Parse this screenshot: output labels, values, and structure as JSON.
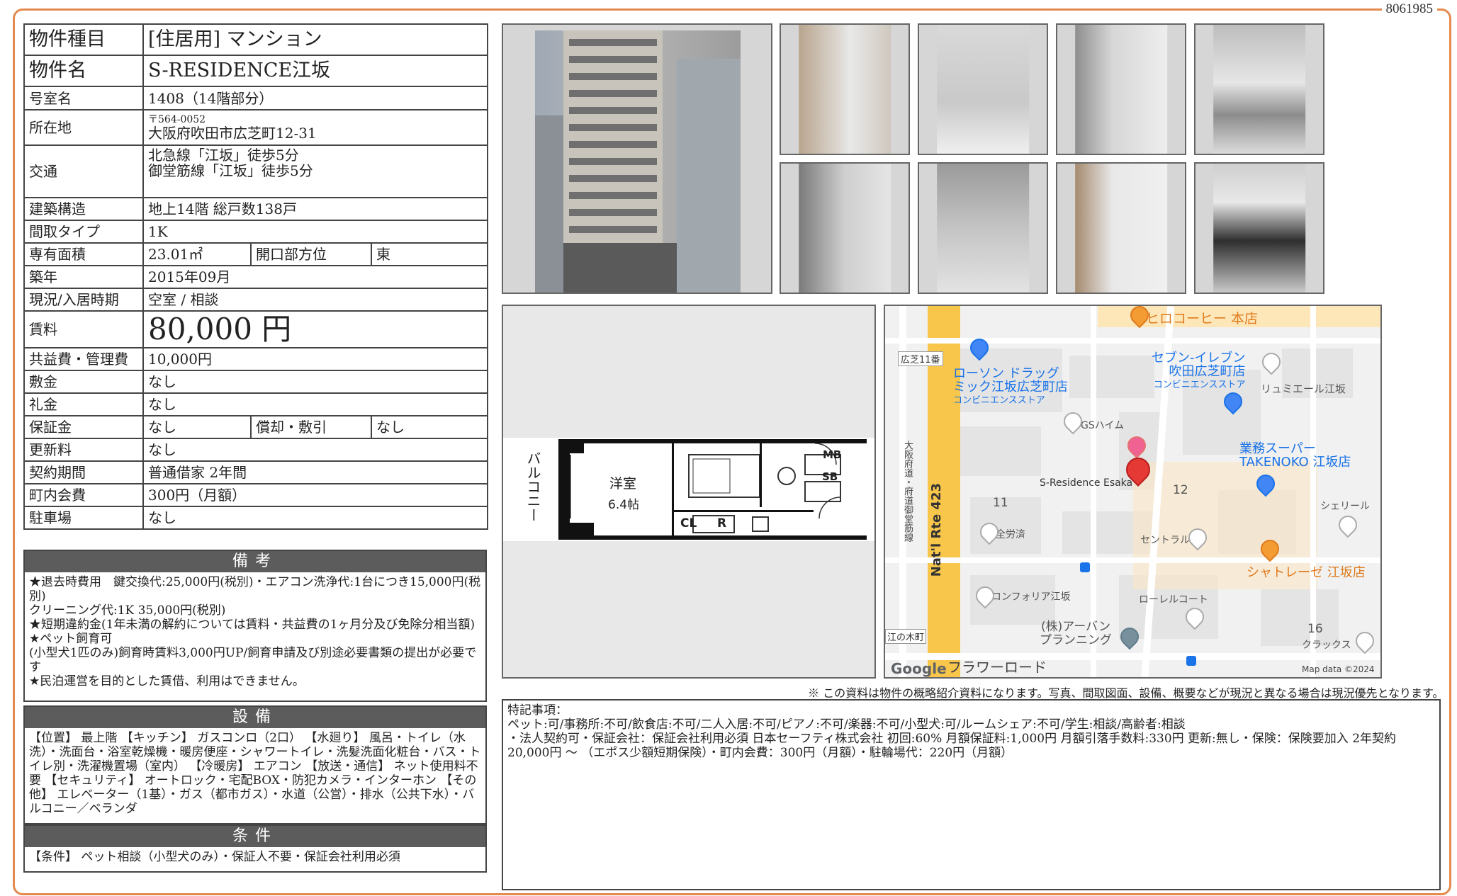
{
  "doc_number": "8061985",
  "property": {
    "type_label": "物件種目",
    "type_value": "[住居用] マンション",
    "name_label": "物件名",
    "name_value": "S-RESIDENCE江坂",
    "room_label": "号室名",
    "room_value": "1408（14階部分）",
    "address_label": "所在地",
    "postal": "〒564-0052",
    "address": "大阪府吹田市広芝町12-31",
    "access_label": "交通",
    "access_1": "北急線「江坂」徒歩5分",
    "access_2": "御堂筋線「江坂」徒歩5分",
    "structure_label": "建築構造",
    "structure_value": "地上14階 総戸数138戸",
    "layout_label": "間取タイプ",
    "layout_value": "1K",
    "area_label": "専有面積",
    "area_value": "23.01㎡",
    "facing_label": "開口部方位",
    "facing_value": "東",
    "built_label": "築年",
    "built_value": "2015年09月",
    "status_label": "現況/入居時期",
    "status_value": "空室 / 相談",
    "rent_label": "賃料",
    "rent_value": "80,000 円",
    "fee_label": "共益費・管理費",
    "fee_value": "10,000円",
    "deposit_label": "敷金",
    "deposit_value": "なし",
    "key_money_label": "礼金",
    "key_money_value": "なし",
    "guarantee_label": "保証金",
    "guarantee_value": "なし",
    "amort_label": "償却・敷引",
    "amort_value": "なし",
    "renewal_label": "更新料",
    "renewal_value": "なし",
    "contract_label": "契約期間",
    "contract_value": "普通借家 2年間",
    "town_fee_label": "町内会費",
    "town_fee_value": "300円（月額）",
    "parking_label": "駐車場",
    "parking_value": "なし"
  },
  "remarks_section": {
    "title": "備考",
    "text": "★退去時費用　鍵交換代:25,000円(税別)・エアコン洗浄代:1台につき15,000円(税別)\nクリーニング代:1K 35,000円(税別)\n★短期違約金(1年未満の解約については賃料・共益費の1ヶ月分及び免除分相当額)\n★ペット飼育可\n(小型犬1匹のみ)飼育時賃料3,000円UP/飼育申請及び別途必要書類の提出が必要です\n★民泊運営を目的とした賃借、利用はできません。"
  },
  "equipment_section": {
    "title": "設備",
    "text": "【位置】 最上階 【キッチン】 ガスコンロ（2口） 【水廻り】 風呂・トイレ（水洗）・洗面台・浴室乾燥機・暖房便座・シャワートイレ・洗髪洗面化粧台・バス・トイレ別・洗濯機置場（室内） 【冷暖房】 エアコン 【放送・通信】 ネット使用料不要 【セキュリティ】 オートロック・宅配BOX・防犯カメラ・インターホン 【その他】 エレベーター（1基）・ガス（都市ガス）・水道（公営）・排水（公共下水）・バルコニー／ベランダ"
  },
  "conditions_section": {
    "title": "条件",
    "text": "【条件】 ペット相談（小型犬のみ）・保証人不要・保証会社利用必須"
  },
  "floorplan": {
    "balcony": "バルコニー",
    "room_name": "洋室",
    "room_size": "6.4帖",
    "mb": "MB",
    "sb": "SB",
    "cl": "CL",
    "r": "R"
  },
  "map": {
    "labels": {
      "hiro_coffee": "ヒロコーヒー 本店",
      "hiroshiba11": "広芝11番",
      "lawson_1": "ローソン ドラッグ",
      "lawson_2": "ミック江坂広芝町店",
      "lawson_3": "コンビニエンスストア",
      "seven_1": "セブン-イレブン",
      "seven_2": "吹田広芝町店",
      "seven_3": "コンビニエンスストア",
      "ryumi": "リュミエール江坂",
      "gs": "GSハイム",
      "gyomu_1": "業務スーパー",
      "gyomu_2": "TAKENOKO 江坂店",
      "target": "S-Residence Esaka",
      "n11": "11",
      "n12": "12",
      "sheriru": "シェリール",
      "zenrosai": "全労済",
      "central": "セントラル",
      "chatrese": "シャトレーゼ 江坂店",
      "route_jp": "大阪府道・府道御堂筋線",
      "route_en": "Nat'l Rte 423",
      "conforia": "コンフォリア江坂",
      "laurel": "ローレルコート",
      "urban_1": "(株)アーバン",
      "urban_2": "プランニング",
      "n16": "16",
      "clux": "クラックス",
      "enoki": "江の木町",
      "flower": "フラワーロード",
      "google": "Google",
      "mapdata": "Map data ©2024"
    }
  },
  "footnote": "※ この資料は物件の概略紹介資料になります。写真、間取図面、設備、概要などが現況と異なる場合は現況優先となります。",
  "special_notes": {
    "title": "特記事項：",
    "text": "ペット:可/事務所:不可/飲食店:不可/二人入居:不可/ピアノ:不可/楽器:不可/小型犬:可/ルームシェア:不可/学生:相談/高齢者:相談\n・法人契約可・保証会社：保証会社利用必須 日本セーフティ株式会社 初回:60% 月額保証料:1,000円 月額引落手数料:330円 更新:無し・保険：保険要加入 2年契約 20,000円 〜 （エポス少額短期保険）・町内会費：300円（月額）・駐輪場代：220円（月額）"
  },
  "colors": {
    "frame": "#e58a4e",
    "section_header": "#5c5c5c",
    "map_road": "#f7c64a",
    "map_pin": "#e53935"
  }
}
